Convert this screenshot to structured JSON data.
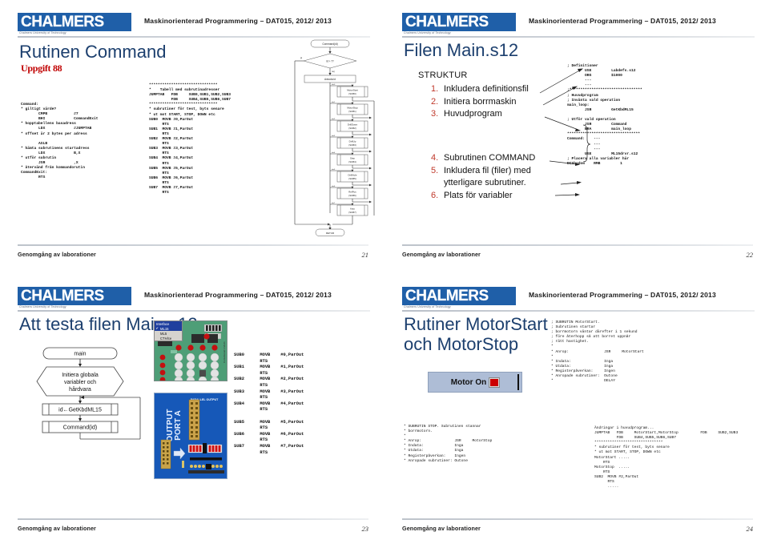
{
  "header": {
    "logo_word": "CHALMERS",
    "logo_subtitle": "Chalmers University of Technology",
    "course_line": "Maskinorienterad Programmering – DAT015, 2012/ 2013"
  },
  "footer": {
    "text": "Genomgång av laborationer"
  },
  "slides": [
    {
      "number": "21",
      "title": "Rutinen Command",
      "subtitle": "Uppgift 88",
      "code_left": "Command:\n* giltigt värde?\n        CMPB            #7\n        BHI             CommandExit\n* hopptabellens basadress\n        LDX             #JUMPTAB\n* offset är 2 bytes per adress\n\n        ASLB\n* hämta subrutinens startadress\n        LDX             B,X\n* utför subrutin\n        JSR             ,X\n* återvänd från kommandorutin\nCommandExit:\n        RTS",
      "code_mid": "*******************************\n*    Tabell med subrutinadresser\nJUMPTAB   FDB     SUB0,SUB1,SUB2,SUB3\n          FDB     SUB4,SUB5,SUB6,SUB7\n*******************************\n* subrutiner för test, byts senare\n* ut mot START, STOP, DOWN etc\nSUB0  MOVB #0,ParOut\n      RTS\nSUB1  MOVB #1,ParOut\n      RTS\nSUB2  MOVB #2,ParOut\n      RTS\nSUB3  MOVB #3,ParOut\n      RTS\nSUB4  MOVB #4,ParOut\n      RTS\nSUB5  MOVB #5,ParOut\n      RTS\nSUB6  MOVB #6,ParOut\n      RTS\nSUB7  MOVB #7,ParOut\n      RTS",
      "flowchart": {
        "start": "Command(id)",
        "decision": "id > 7?",
        "decision_yes": "ja",
        "decision_no": "nej",
        "decode": "Avkoda id",
        "branches": [
          {
            "label": "id=0",
            "name": "MotorStart",
            "sub": "(SUB0)"
          },
          {
            "label": "id=1",
            "name": "MotorStop",
            "sub": "(SUB1)"
          },
          {
            "label": "id=2",
            "name": "DrillDown",
            "sub": "(SUB2)"
          },
          {
            "label": "id=3",
            "name": "DrillUp",
            "sub": "(SUB3)"
          },
          {
            "label": "id=4",
            "name": "Step",
            "sub": "(SUB4)"
          },
          {
            "label": "id=5",
            "name": "DrillHole",
            "sub": "(SUB5)"
          },
          {
            "label": "id=6",
            "name": "RefPos",
            "sub": "(SUB6)"
          },
          {
            "label": "id=7",
            "name": "Auto",
            "sub": "(SUB7)"
          }
        ],
        "end": "RETUR"
      }
    },
    {
      "number": "22",
      "title": "Filen Main.s12",
      "struct_label": "STRUKTUR",
      "steps": [
        "Inkludera definitionsfil",
        "Initiera borrmaskin",
        "Huvudprogram",
        "Subrutinen COMMAND",
        "Inkludera fil (filer) med\nytterligare subrutiner.",
        "Plats för variabler"
      ],
      "code_right": "; Definitioner\n        USE         Labdefs.s12\n        ORG         $1000\n        ---\n        ---\n;*********************************\n; Huvudprogram\n; Invänta vald operation\nmain_loop:\n        JSR         GetKbdML15\n\n; Utför vald operation\n        JSR         Command\n        BRA         main_loop\n*********************************\nCommand:    ---\n            ---\n            ---\n        USE         ML15drvr.s12\n; Placera alla variabler här\nDCShadow    RMB         1"
    },
    {
      "number": "23",
      "title": "Att testa filen Main.s12",
      "flowchart": {
        "start": "main",
        "init": "Initiera globala\nvariabler och\nhårdvara",
        "call1": "id←GetKbdML15",
        "call2": "Command(id)"
      },
      "interface_dropdown": {
        "title": "Interface",
        "options": [
          "ML15",
          "ML5",
          "CTH/ce"
        ],
        "selected": "ML15"
      },
      "parallel_panel": {
        "caption": "PARALLEL OUTPUT",
        "label": "OUTPUT\nPORT A"
      },
      "code_right": "SUB0      MOVB    #0,ParOut\n          RTS\nSUB1      MOVB    #1,ParOut\n          RTS\nSUB2      MOVB    #2,ParOut\n          RTS\nSUB3      MOVB    #3,ParOut\n          RTS\nSUB4      MOVB    #4,ParOut\n          RTS\n\nSUB5      MOVB    #5,ParOut\n          RTS\nSUB6      MOVB    #6,ParOut\n          RTS\nSUB7      MOVB    #7,ParOut\n          RTS"
    },
    {
      "number": "24",
      "title": "Rutiner MotorStart\noch MotorStop",
      "motor_button": {
        "label": "Motor On",
        "led_color": "#cc0000"
      },
      "code_top_right": "; SUBRUTIN MotorStart.\n; Subrutinen startar\n; borrmotorn väntar därefter i 1 sekund\n; före återhopp så att borret uppnår\n; rätt hastighet.\n*\n* Anrop:                JSR     MotorStart\n*\n* Indata:               Inga\n* Utdata:               Inga\n* Registerpåverkan:     Ingen\n* Anropade subrutiner:  Outone\n*                       DELAY",
      "code_bottom_left": "* SUBRUTIN STOP. Subrutinen stannar\n* borrmotorn.\n*\n* Anrop:               JSR     MotorStop\n* Indata:              Inga\n* Utdata:              Inga\n* Registerpåverkan:    Ingen\n* Anropade subrutiner: Outone",
      "code_bottom_right_1": "Ändringar i huvudprogram...\nJUMPTAB   FDB     ",
      "code_bottom_right_green1": "MotorStart,MotorStop",
      "code_bottom_right_2": "          FDB     SUB2,SUB3\n          FDB     SUB4,SUB5,SUB6,SUB7\n*******************************\n* subrutiner för test, byts senare\n* ut mot START, STOP, DOWN etc\n",
      "code_bottom_right_green2": "MotorStart",
      "code_bottom_right_3": " .....\n    RTS\n",
      "code_bottom_right_green3": "MotorStop",
      "code_bottom_right_4": "  .....\n    RTS\nSUB2  MOVB #2,ParOut\n      RTS\n      ....."
    }
  ],
  "colors": {
    "brand_blue": "#1f5fa8",
    "title_blue": "#1c3f6e",
    "accent_red": "#c0392b",
    "green_code": "#1a9c6e"
  }
}
